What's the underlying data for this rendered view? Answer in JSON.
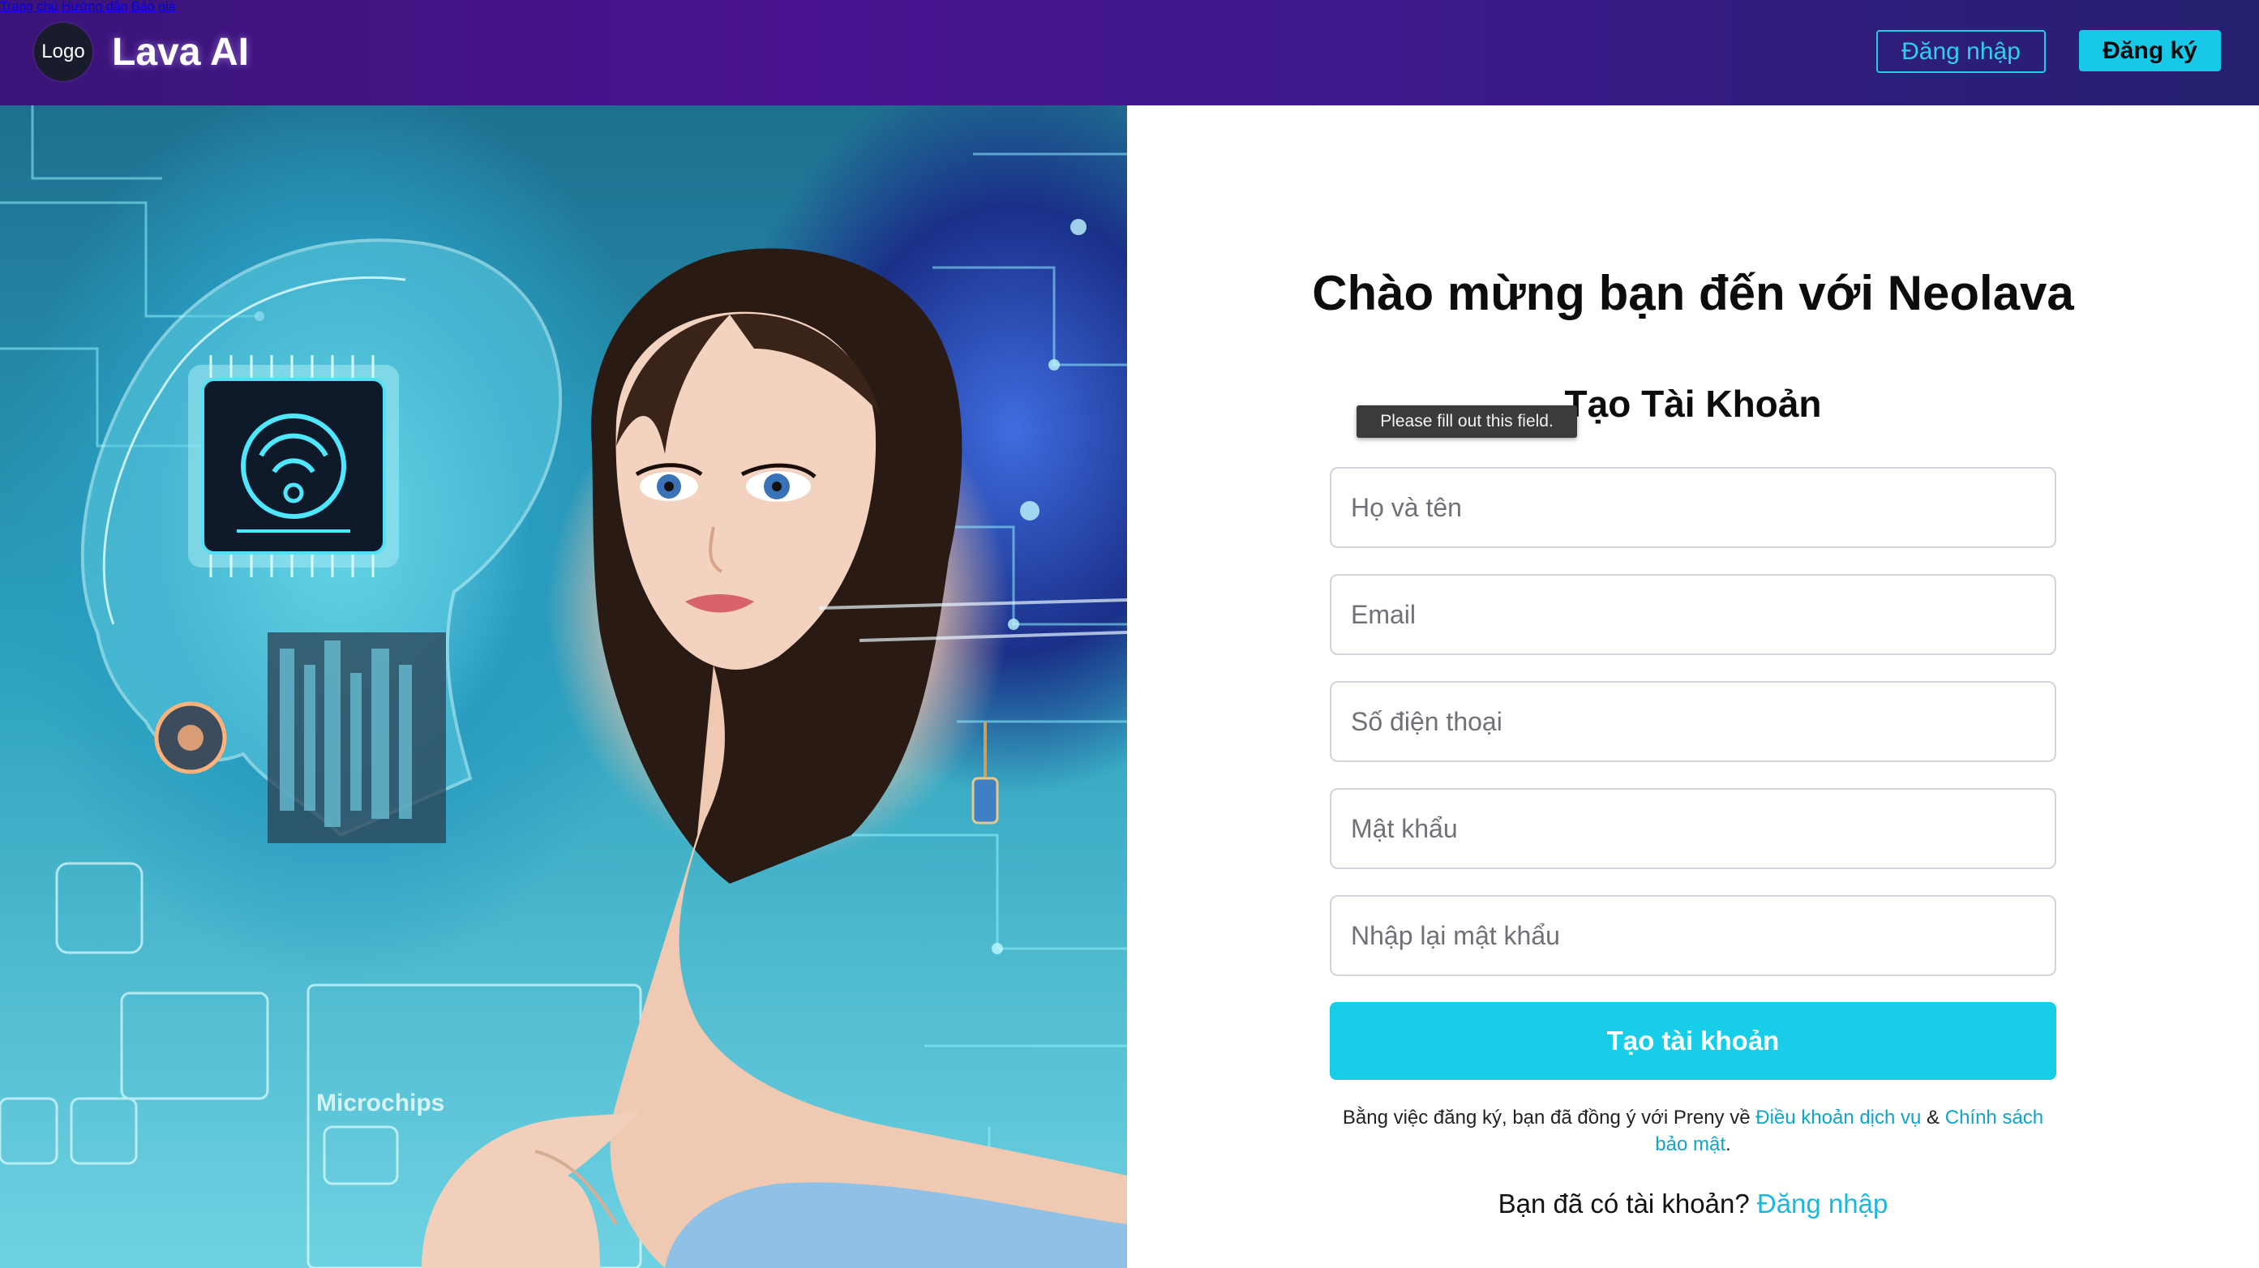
{
  "header": {
    "logo_text": "Logo",
    "brand": "Lava AI",
    "nav": [
      {
        "label": "Trang chủ"
      },
      {
        "label": "Hướng dẫn"
      },
      {
        "label": "Báo giá"
      }
    ],
    "login_label": "Đăng nhập",
    "register_label": "Đăng ký"
  },
  "hero": {
    "chip_label": "Microchips"
  },
  "form": {
    "welcome": "Chào mừng bạn đến với Neolava",
    "subtitle": "Tạo Tài Khoản",
    "tooltip": "Please fill out this field.",
    "fields": [
      {
        "placeholder": "Họ và tên",
        "value": ""
      },
      {
        "placeholder": "Email",
        "value": ""
      },
      {
        "placeholder": "Số điện thoại",
        "value": ""
      },
      {
        "placeholder": "Mật khẩu",
        "value": ""
      },
      {
        "placeholder": "Nhập lại mật khẩu",
        "value": ""
      }
    ],
    "submit_label": "Tạo tài khoản",
    "terms_prefix": "Bằng việc đăng ký, bạn đã đồng ý với Preny về ",
    "terms_link": "Điều khoản dịch vụ",
    "terms_and": " & ",
    "privacy_link": "Chính sách bảo mật",
    "terms_suffix": ".",
    "have_account": "Bạn đã có tài khoản? ",
    "login_link": "Đăng nhập"
  },
  "colors": {
    "accent": "#17cde8",
    "header_start": "#3a1478",
    "header_end": "#24206e",
    "link": "#0ea5c9"
  }
}
